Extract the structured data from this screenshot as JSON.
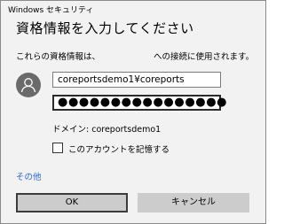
{
  "window": {
    "title": "Windows セキュリティ"
  },
  "heading": "資格情報を入力してください",
  "description": {
    "before": "これらの資格情報は、",
    "after": "への接続に使用されます。"
  },
  "username": {
    "value": "coreportsdemo1¥coreports"
  },
  "password": {
    "masked": "●●●●●●●●●●●●●●●●"
  },
  "domain": "ドメイン: coreportsdemo1",
  "remember": {
    "label": "このアカウントを記憶する",
    "checked": false
  },
  "more_link": "その他",
  "buttons": {
    "ok": "OK",
    "cancel": "キャンセル"
  },
  "colors": {
    "link": "#2a64c8",
    "avatar": "#6a6a6a",
    "button": "#cccccc"
  }
}
